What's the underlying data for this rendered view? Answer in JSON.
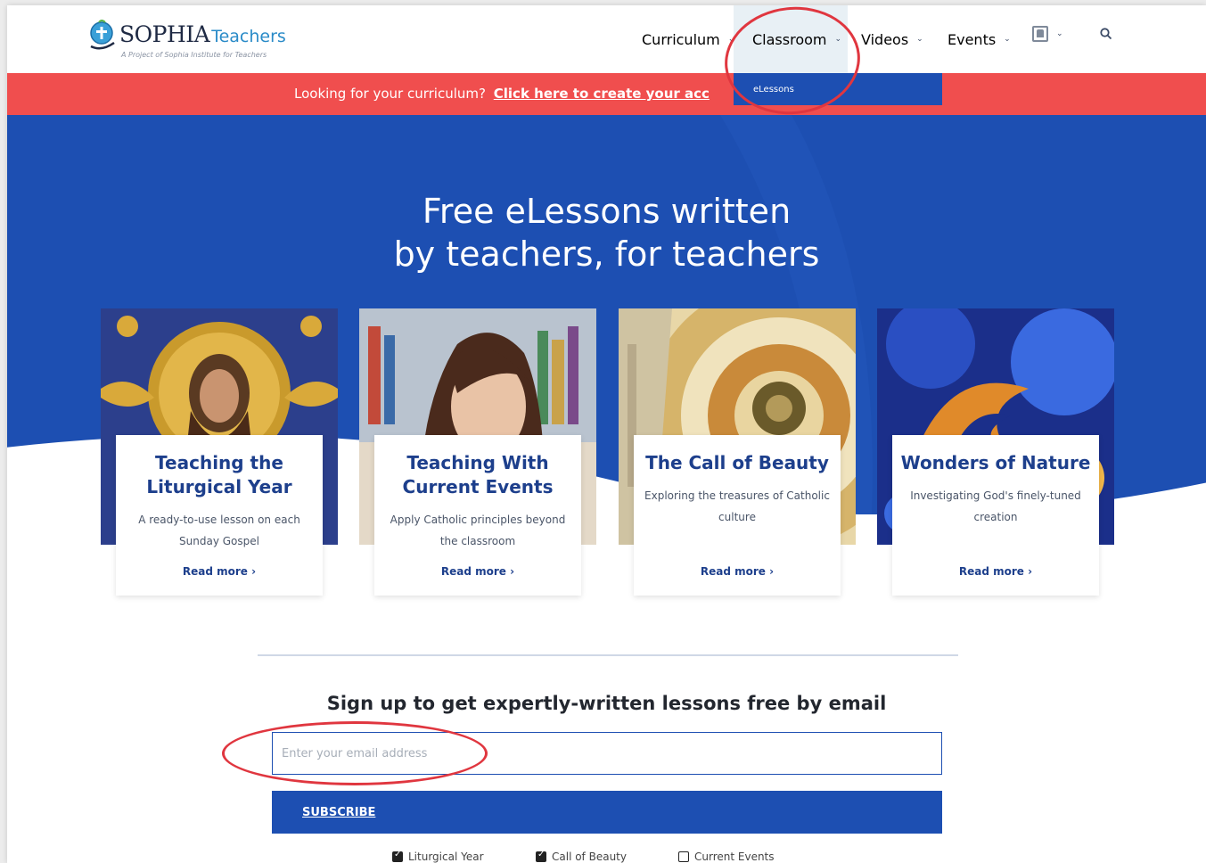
{
  "header": {
    "logo_title": "SOPHIA",
    "logo_subtitle": "Teachers",
    "logo_tagline": "A Project of Sophia Institute for Teachers",
    "nav": [
      {
        "label": "Curriculum"
      },
      {
        "label": "Classroom"
      },
      {
        "label": "Videos"
      },
      {
        "label": "Events"
      }
    ],
    "classroom_dropdown": {
      "item": "eLessons"
    }
  },
  "banner": {
    "text": "Looking for your curriculum?",
    "link": "Click here to create your acc"
  },
  "hero": {
    "title_line1": "Free eLessons written",
    "title_line2": "by teachers, for teachers"
  },
  "cards": [
    {
      "title": "Teaching the Liturgical Year",
      "desc": "A ready-to-use lesson on each Sunday Gospel",
      "link": "Read more"
    },
    {
      "title": "Teaching With Current Events",
      "desc": "Apply Catholic principles beyond the classroom",
      "link": "Read more"
    },
    {
      "title": "The Call of Beauty",
      "desc": "Exploring the treasures of Catholic culture",
      "link": "Read more"
    },
    {
      "title": "Wonders of Nature",
      "desc": "Investigating God's finely-tuned creation",
      "link": "Read more"
    }
  ],
  "signup": {
    "heading": "Sign up to get expertly-written lessons free by email",
    "email_placeholder": "Enter your email address",
    "subscribe": "SUBSCRIBE",
    "options": [
      {
        "label": "Liturgical Year",
        "checked": true
      },
      {
        "label": "Call of Beauty",
        "checked": true
      },
      {
        "label": "Current Events",
        "checked": false
      }
    ]
  },
  "colors": {
    "brand_blue": "#1d4fb2",
    "banner_red": "#f04e4e",
    "title_blue": "#1d3f8c",
    "annotation_red": "#e0363f"
  },
  "icons": [
    "logo-globe-icon",
    "chevron-down-icon",
    "profile-icon",
    "search-icon",
    "chevron-right-icon",
    "checkbox-icon"
  ]
}
